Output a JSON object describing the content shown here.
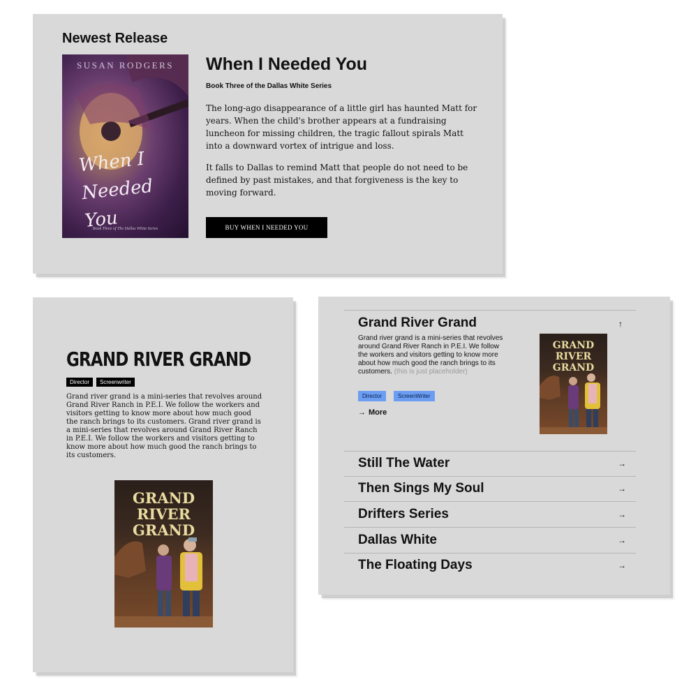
{
  "newest_release": {
    "heading": "Newest Release",
    "cover": {
      "author": "SUSAN RODGERS",
      "title": "When I Needed You",
      "subtitle": "Book Three of The Dallas White Series"
    },
    "book_title": "When I Needed You",
    "book_subtitle": "Book Three of the Dallas White Series",
    "paragraph1": "The long-ago disappearance of a little girl has haunted Matt for years. When the child's brother appears at a fundraising luncheon for missing children, the tragic fallout spirals Matt into a downward vortex of intrigue and loss.",
    "paragraph2": "It falls to Dallas to remind Matt that people do not need to be defined by past mistakes, and that forgiveness is the key to moving forward.",
    "buy_label": "BUY WHEN I NEEDED YOU"
  },
  "project_detail": {
    "title": "GRAND RIVER GRAND",
    "tags": [
      "Director",
      "Screenwriter"
    ],
    "description": "Grand river grand is a mini-series that revolves around Grand River Ranch in P.E.I. We follow the workers and visitors getting to know more about how much good the ranch brings to its customers. Grand river grand is a mini-series that revolves around Grand River Ranch in P.E.I. We follow the workers and visitors getting to know more about how much good the ranch brings to its customers.",
    "poster_text": [
      "GRAND",
      "RIVER",
      "GRAND"
    ]
  },
  "accordion": {
    "open_item": {
      "title": "Grand River Grand",
      "description": "Grand river grand is a mini-series that revolves around Grand River Ranch in P.E.I. We follow the workers and visitors getting to know more about how much good the ranch brings to its customers.",
      "placeholder_note": "(this is just placeholder)",
      "tags": [
        "Director",
        "ScreenWriter"
      ],
      "more_label": "More",
      "poster_text": [
        "GRAND",
        "RIVER",
        "GRAND"
      ]
    },
    "items": [
      {
        "label": "Still The Water"
      },
      {
        "label": "Then Sings My Soul"
      },
      {
        "label": "Drifters Series"
      },
      {
        "label": "Dallas White"
      },
      {
        "label": "The Floating Days"
      }
    ]
  },
  "colors": {
    "panel_bg": "#d9d9d9",
    "tag_dark": "#000000",
    "tag_blue": "#6b9df2",
    "button_bg": "#000000"
  },
  "icons": {
    "collapse": "arrow-up-icon",
    "expand": "arrow-right-icon",
    "more": "arrow-right-icon"
  }
}
